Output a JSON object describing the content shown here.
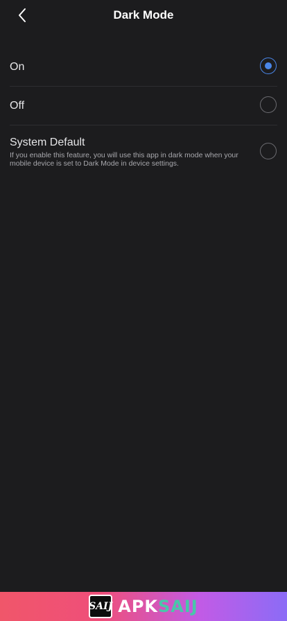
{
  "header": {
    "title": "Dark Mode",
    "back_icon": "chevron-left-icon"
  },
  "options": [
    {
      "label": "On",
      "checked": true
    },
    {
      "label": "Off",
      "checked": false
    },
    {
      "label": "System Default",
      "description": "If you enable this feature, you will use this app in dark mode when your mobile device is set to Dark Mode in device settings.",
      "checked": false
    }
  ],
  "banner": {
    "logo_text": "SAIJ",
    "brand_part1": "APK",
    "brand_part2": "SAIJ"
  },
  "colors": {
    "background": "#1c1c1e",
    "accent": "#4a86e8",
    "divider": "#2e2e31"
  }
}
